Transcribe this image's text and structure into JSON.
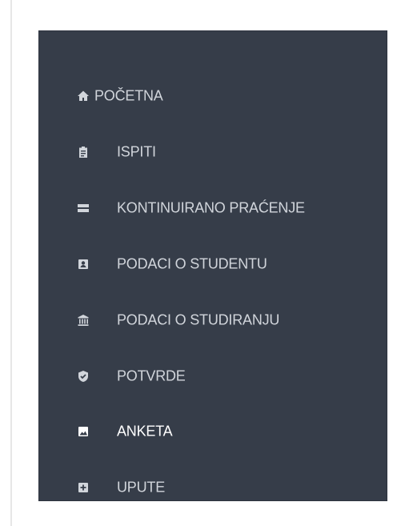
{
  "sidebar": {
    "items": [
      {
        "label": "POČETNA",
        "icon": "home-icon"
      },
      {
        "label": "ISPITI",
        "icon": "clipboard-icon"
      },
      {
        "label": "KONTINUIRANO PRAĆENJE",
        "icon": "list-icon"
      },
      {
        "label": "PODACI O STUDENTU",
        "icon": "user-card-icon"
      },
      {
        "label": "PODACI O STUDIRANJU",
        "icon": "institution-icon"
      },
      {
        "label": "POTVRDE",
        "icon": "shield-check-icon"
      },
      {
        "label": "ANKETA",
        "icon": "image-icon"
      },
      {
        "label": "UPUTE",
        "icon": "plus-square-icon"
      }
    ],
    "active_label": "ANKETA",
    "colors": {
      "background": "#363d49",
      "text": "#d1d5db",
      "active_text": "#ffffff"
    }
  }
}
